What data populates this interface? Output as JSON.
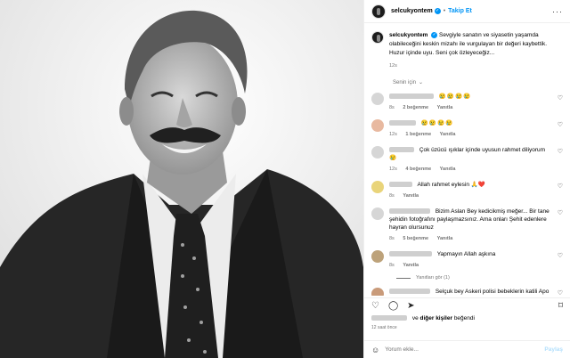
{
  "header": {
    "username": "selcukyontem",
    "separator": "•",
    "follow_label": "Takip Et",
    "more_label": "···"
  },
  "caption": {
    "username": "selcukyontem",
    "text": "Sevgiyle sanatın ve siyasetin yaşamda olabileceğini keskin mizahı ile vurgulayan bir değeri kaybettik. Huzur içinde uyu. Seni çok özleyeceğiz...",
    "time": "12s"
  },
  "senin_icin": "Senin için",
  "comments": [
    {
      "text": "😢😢😢😢",
      "time": "8s",
      "likes": "2 beğenme",
      "reply": "Yanıtla"
    },
    {
      "text": "😢😢😢😢",
      "time": "12s",
      "likes": "1 beğenme",
      "reply": "Yanıtla"
    },
    {
      "text": "Çok üzücü ışıklar içinde uyusun rahmet diliyorum 😢",
      "time": "12s",
      "likes": "4 beğenme",
      "reply": "Yanıtla"
    },
    {
      "text": "Allah rahmet eylesin 🙏❤️",
      "time": "8s",
      "likes": "",
      "reply": "Yanıtla"
    },
    {
      "text": "Bizim Aslan Bey kedicikmiş meğer... Bir tane şehidin fotoğrafını paylaşmazsınız. Ama onları Şehit edenlere hayran olursunuz",
      "time": "8s",
      "likes": "5 beğenme",
      "reply": "Yanıtla"
    },
    {
      "text": "Yapmayın Allah aşkına",
      "time": "8s",
      "likes": "",
      "reply": "Yanıtla"
    }
  ],
  "view_replies": "Yanıtları gör (1)",
  "last_comment": "Selçuk bey Askeri polisi bebeklerin katili Apo",
  "likes_line": {
    "suffix": "ve",
    "others": "diğer kişiler",
    "end": "beğendi"
  },
  "post_time": "12 saat önce",
  "add_comment": {
    "placeholder": "Yorum ekle...",
    "post_label": "Paylaş"
  },
  "icons": {
    "heart": "heart-icon",
    "comment": "comment-icon",
    "share": "share-icon",
    "save": "bookmark-icon",
    "emoji": "emoji-icon"
  },
  "colors": {
    "link_blue": "#0095f6",
    "muted": "#737373",
    "post_disabled": "#b2dffc"
  }
}
